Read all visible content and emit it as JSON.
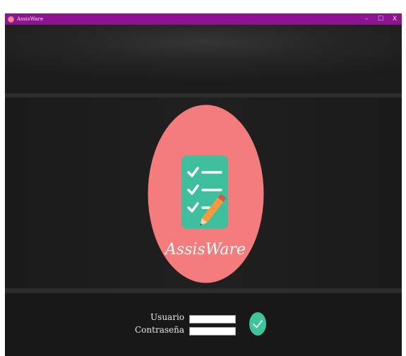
{
  "window": {
    "title": "AssisWare",
    "controls": {
      "minimize": "–",
      "maximize": "☐",
      "close": "X"
    }
  },
  "logo": {
    "text": "AssisWare",
    "icon": "checklist-with-pencil-icon",
    "colors": {
      "circle": "#f47c7c",
      "clipboard": "#3fbf9e",
      "pencil": "#f29b3e",
      "text": "#ffffff"
    }
  },
  "login": {
    "user_label": "Usuario",
    "user_value": "",
    "password_label": "Contraseña",
    "password_value": "",
    "submit_icon": "check-icon",
    "submit_color": "#3fc49b"
  },
  "colors": {
    "titlebar": "#8e1391",
    "background": "#1e1e1e"
  }
}
